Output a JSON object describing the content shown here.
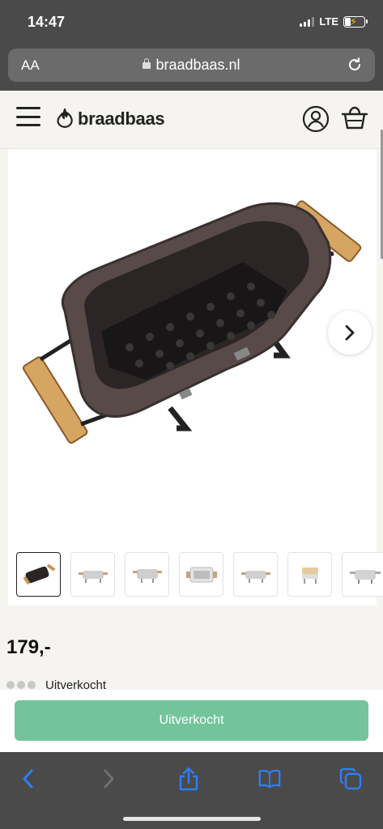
{
  "status_bar": {
    "time": "14:47",
    "network": "LTE"
  },
  "browser": {
    "text_size_label": "AA",
    "url": "braadbaas.nl"
  },
  "header": {
    "logo_text": "braadbaas"
  },
  "gallery": {
    "thumbnail_count": 7,
    "active_thumbnail": 1
  },
  "product": {
    "price": "179,-",
    "stock_status": "Uitverkocht"
  },
  "sticky": {
    "button_label": "Uitverkocht"
  },
  "colors": {
    "brand_button": "#74c49b",
    "ios_chrome": "#4a4a4a",
    "safari_icon": "#2f7df6"
  },
  "icons": {
    "hamburger": "hamburger-menu-icon",
    "logo": "flame-logo-icon",
    "account": "user-account-icon",
    "cart": "shopping-basket-icon",
    "next": "chevron-right-icon",
    "back": "back-arrow-icon",
    "forward": "forward-arrow-icon",
    "share": "share-icon",
    "bookmarks": "book-icon",
    "tabs": "tabs-icon"
  }
}
